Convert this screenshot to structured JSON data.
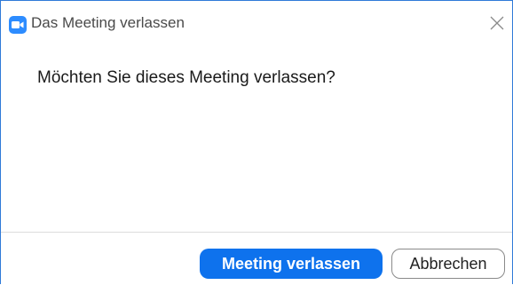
{
  "window": {
    "title": "Das Meeting verlassen",
    "app_icon": "video-camera-icon",
    "close_icon": "close-icon"
  },
  "dialog": {
    "message": "Möchten Sie dieses Meeting verlassen?"
  },
  "buttons": {
    "primary_label": "Meeting verlassen",
    "secondary_label": "Abbrechen"
  },
  "colors": {
    "accent": "#0e72ed",
    "window_border": "#2f7ad8",
    "icon_blue": "#2d8cff"
  }
}
